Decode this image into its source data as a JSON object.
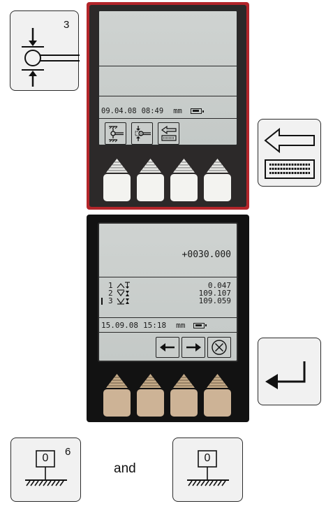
{
  "symbol_probe": {
    "number": "3",
    "icon": "probe-contact-icon"
  },
  "device_top": {
    "status": {
      "date": "09.04.08",
      "time": "08:49",
      "unit": "mm"
    },
    "softkeys": [
      {
        "icon": "measure-table-icon"
      },
      {
        "icon": "probe-measure-icon"
      },
      {
        "icon": "back-keyboard-icon"
      }
    ]
  },
  "symbol_back_keyboard": {
    "icon": "back-keyboard-icon"
  },
  "device_bottom": {
    "reading": "+0030.000",
    "rows": [
      {
        "index": "1",
        "value": "0.047",
        "selected": false
      },
      {
        "index": "2",
        "value": "109.107",
        "selected": false
      },
      {
        "index": "3",
        "value": "109.059",
        "selected": true
      }
    ],
    "status": {
      "date": "15.09.08",
      "time": "15:18",
      "unit": "mm"
    },
    "softkeys": [
      {
        "icon": "arrow-left-icon"
      },
      {
        "icon": "arrow-right-icon"
      },
      {
        "icon": "cancel-icon"
      }
    ]
  },
  "symbol_enter": {
    "icon": "enter-icon"
  },
  "symbol_zero_6": {
    "label": "0",
    "number": "6"
  },
  "connector": {
    "text": "and"
  },
  "symbol_zero": {
    "label": "0"
  },
  "colors": {
    "frame_top": "#b3252a",
    "frame_bottom": "#121212",
    "key_light": "#f3f3f0",
    "key_tan": "#cdb396",
    "key_shadow_arrow": "#b9a17f"
  }
}
